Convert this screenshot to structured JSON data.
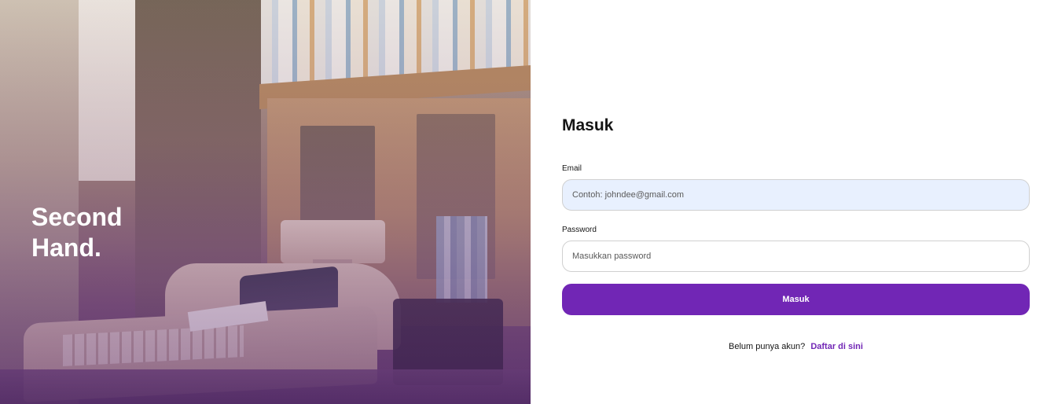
{
  "hero": {
    "brand": "Second\nHand."
  },
  "login": {
    "title": "Masuk",
    "email_label": "Email",
    "email_placeholder": "Contoh: johndee@gmail.com",
    "password_label": "Password",
    "password_placeholder": "Masukkan password",
    "submit_label": "Masuk",
    "register_prompt": "Belum punya akun?",
    "register_link": "Daftar di sini"
  },
  "colors": {
    "accent": "#7126b5",
    "email_field_bg": "#e8f0fe"
  }
}
